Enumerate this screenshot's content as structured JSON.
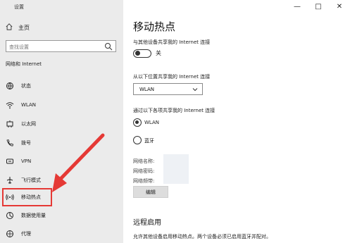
{
  "window": {
    "title": "设置"
  },
  "sidebar": {
    "home_label": "主页",
    "search_placeholder": "查找设置",
    "section_title": "网络和 Internet",
    "items": [
      {
        "label": "状态",
        "icon": "globe-icon"
      },
      {
        "label": "WLAN",
        "icon": "wifi-icon"
      },
      {
        "label": "以太网",
        "icon": "ethernet-icon"
      },
      {
        "label": "拨号",
        "icon": "phone-icon"
      },
      {
        "label": "VPN",
        "icon": "vpn-icon"
      },
      {
        "label": "飞行模式",
        "icon": "airplane-icon"
      },
      {
        "label": "移动热点",
        "icon": "hotspot-icon",
        "active": true
      },
      {
        "label": "数据使用量",
        "icon": "data-usage-icon"
      },
      {
        "label": "代理",
        "icon": "proxy-icon"
      }
    ]
  },
  "content": {
    "title": "移动热点",
    "share_with_others_label": "与其他设备共享我的 Internet 连接",
    "toggle_state_label": "关",
    "share_from_label": "从以下位置共享我的 Internet 连接",
    "share_from_selected": "WLAN",
    "share_over_label": "通过以下各项共享我的 Internet 连接",
    "share_over_options": [
      {
        "label": "WLAN",
        "selected": true
      },
      {
        "label": "蓝牙",
        "selected": false
      }
    ],
    "network_name_label": "网络名称:",
    "network_password_label": "网络密码:",
    "network_band_label": "网络频带:",
    "edit_button_label": "编辑",
    "remote_title": "远程启用",
    "remote_help": "允许其他设备启用移动热点。两个设备必须已启用蓝牙并配对。"
  },
  "colors": {
    "sidebar_bg": "#ebebeb",
    "accent_red": "#e53935"
  }
}
